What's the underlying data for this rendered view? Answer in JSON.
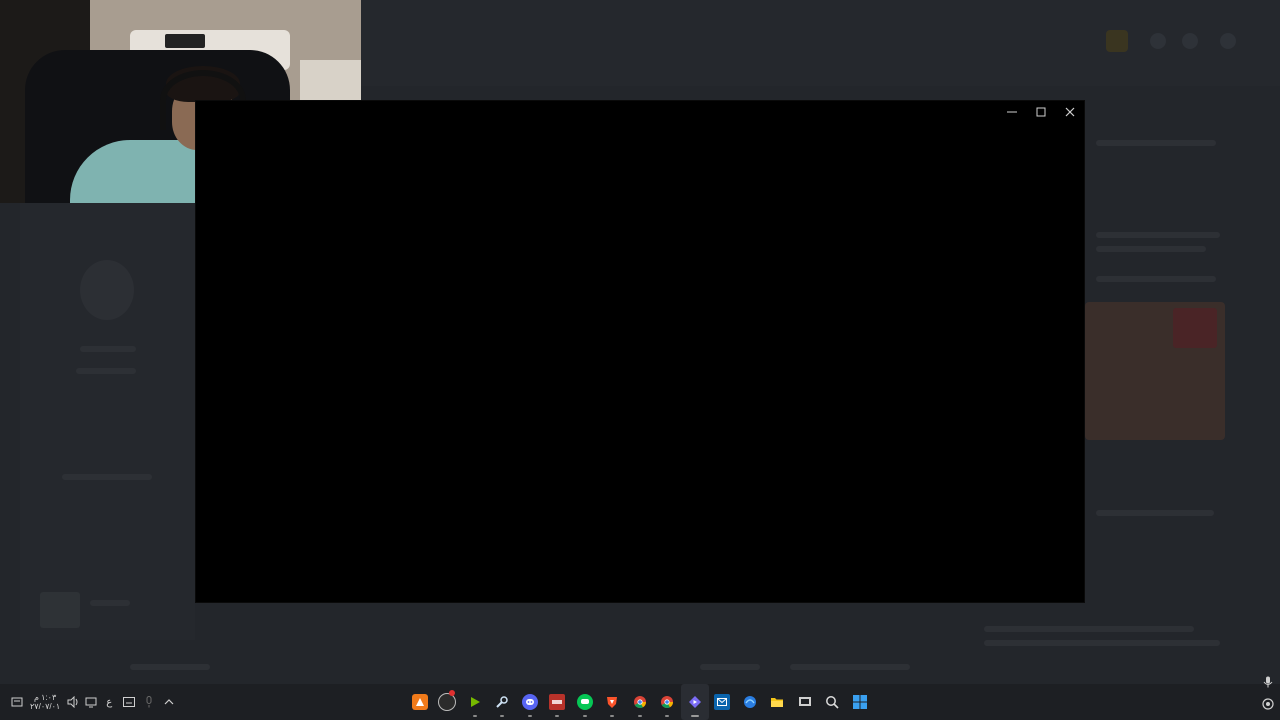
{
  "window": {
    "controls": {
      "minimize": "minimize",
      "maximize": "maximize",
      "close": "close"
    }
  },
  "taskbar": {
    "clock": {
      "time": "١:٠٣ م",
      "date": "٢٧/٠٧/٠١"
    },
    "language": "ع",
    "apps": [
      {
        "name": "ableton",
        "glyph": "",
        "color": "#f07a1a"
      },
      {
        "name": "obs",
        "glyph": "",
        "color": "#3a3a3a"
      },
      {
        "name": "nvidia-geforce",
        "glyph": "▶",
        "color": "#76b900"
      },
      {
        "name": "steam",
        "glyph": "",
        "color": "#1b2838"
      },
      {
        "name": "discord",
        "glyph": "",
        "color": "#5865f2"
      },
      {
        "name": "voicemeeter",
        "glyph": "",
        "color": "#c0392b"
      },
      {
        "name": "line",
        "glyph": "",
        "color": "#06c755"
      },
      {
        "name": "brave",
        "glyph": "",
        "color": "#fb542b"
      },
      {
        "name": "chrome",
        "glyph": "",
        "color": "#4285f4"
      },
      {
        "name": "chrome-alt",
        "glyph": "",
        "color": "#34a853"
      },
      {
        "name": "twitch-studio",
        "glyph": "",
        "color": "#6441a5"
      },
      {
        "name": "outlook",
        "glyph": "",
        "color": "#0a64ad"
      },
      {
        "name": "edge",
        "glyph": "",
        "color": "#2a7de1"
      },
      {
        "name": "file-explorer",
        "glyph": "",
        "color": "#f5c518"
      },
      {
        "name": "task-view",
        "glyph": "",
        "color": "#d0d0d0"
      },
      {
        "name": "search",
        "glyph": "",
        "color": "#d0d0d0"
      },
      {
        "name": "start",
        "glyph": "",
        "color": "#3aa0f0"
      }
    ]
  },
  "colors": {
    "window_bg": "#000000",
    "taskbar_bg": "#1d1f23",
    "desktop_bg": "#23262b"
  }
}
